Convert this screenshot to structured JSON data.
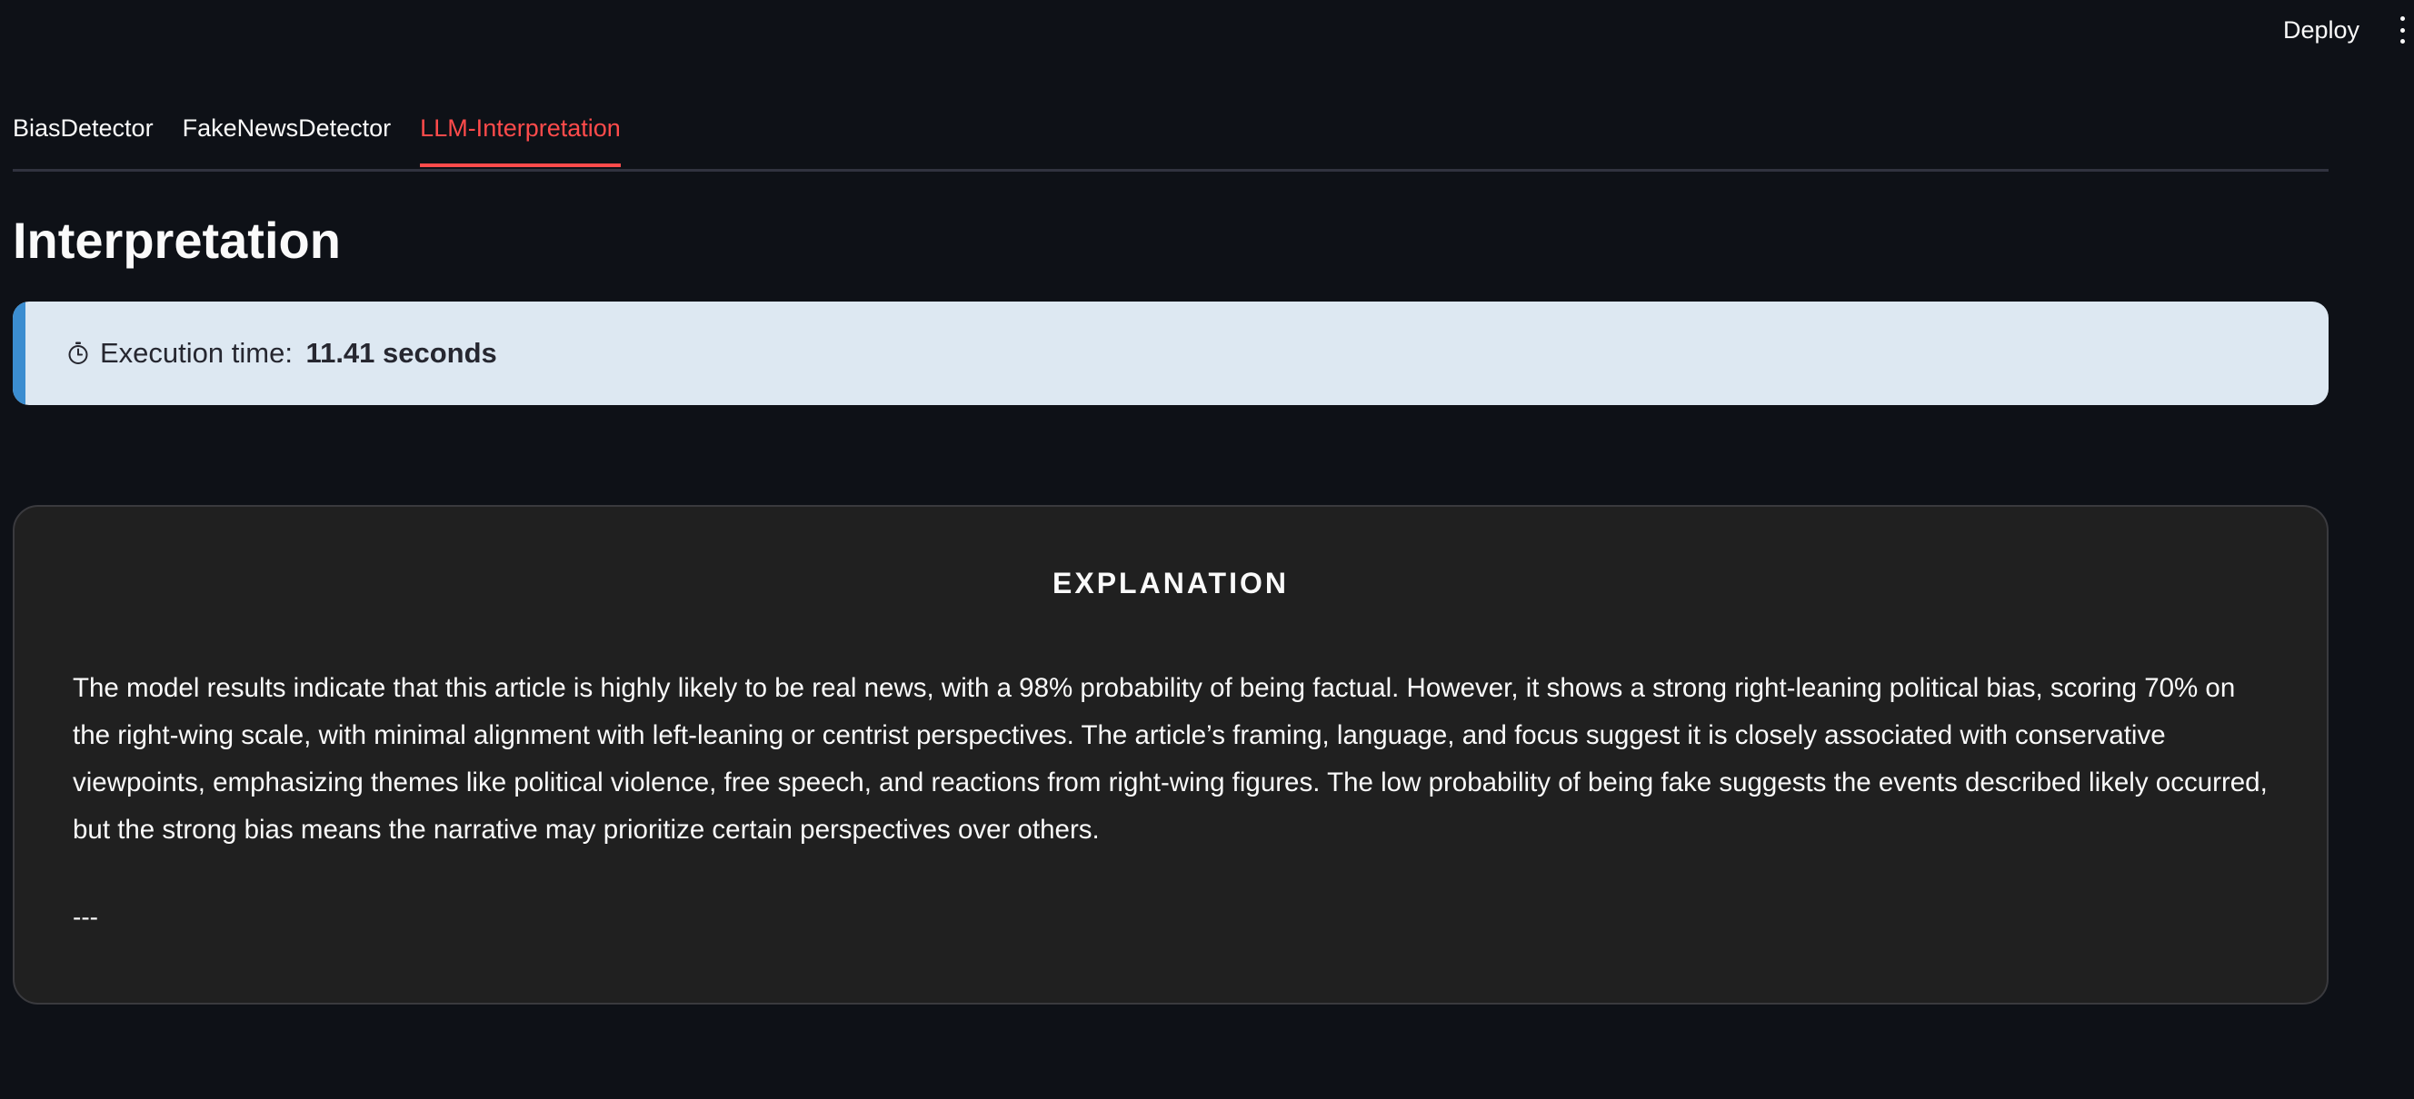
{
  "header": {
    "deploy_label": "Deploy",
    "menu_icon": "kebab-menu-icon"
  },
  "tabs": [
    {
      "label": "BiasDetector",
      "active": false
    },
    {
      "label": "FakeNewsDetector",
      "active": false
    },
    {
      "label": "LLM-Interpretation",
      "active": true
    }
  ],
  "main": {
    "title": "Interpretation",
    "info": {
      "icon": "stopwatch-icon",
      "prefix": "Execution time: ",
      "value": "11.41 seconds"
    },
    "explanation": {
      "heading": "EXPLANATION",
      "body": "The model results indicate that this article is highly likely to be real news, with a 98% probability of being factual. However, it shows a strong right-leaning political bias, scoring 70% on the right-wing scale, with minimal alignment with left-leaning or centrist perspectives. The article’s framing, language, and focus suggest it is closely associated with conservative viewpoints, emphasizing themes like political violence, free speech, and reactions from right-wing figures. The low probability of being fake suggests the events described likely occurred, but the strong bias means the narrative may prioritize certain perspectives over others.",
      "separator": "---"
    }
  },
  "colors": {
    "background": "#0e1117",
    "accent": "#ff4b4b",
    "info_bg": "#dde8f2",
    "info_accent": "#3b8dd0",
    "card_bg": "#202020"
  }
}
